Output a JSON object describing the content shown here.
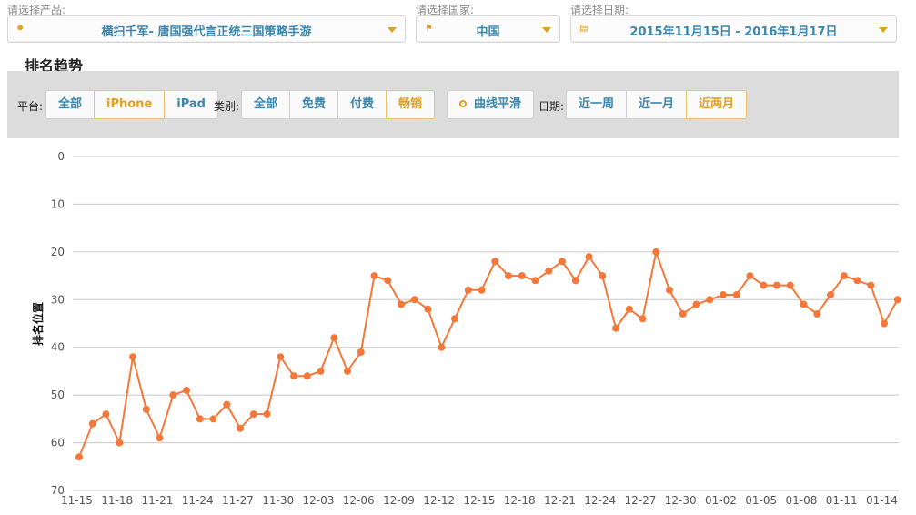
{
  "filters": {
    "product": {
      "label": "请选择产品:",
      "value": "横扫千军- 唐国强代言正统三国策略手游",
      "icon": "gear-icon"
    },
    "country": {
      "label": "请选择国家:",
      "value": "中国",
      "icon": "flag-icon"
    },
    "date": {
      "label": "请选择日期:",
      "value": "2015年11月15日 - 2016年1月17日",
      "icon": "calendar-icon"
    }
  },
  "section_title": "排名趋势",
  "toolbar": {
    "platform": {
      "label": "平台:",
      "options": [
        "全部",
        "iPhone",
        "iPad"
      ],
      "selected": "iPhone"
    },
    "category": {
      "label": "类别:",
      "options": [
        "全部",
        "免费",
        "付费",
        "畅销"
      ],
      "selected": "畅销"
    },
    "smooth": {
      "label": "曲线平滑"
    },
    "period": {
      "label": "日期:",
      "options": [
        "近一周",
        "近一月",
        "近两月"
      ],
      "selected": "近两月"
    }
  },
  "colors": {
    "accent": "#e0a020",
    "link": "#3a86ae",
    "line": "#f4783a",
    "grid": "#c8c8c8"
  },
  "chart_data": {
    "type": "line",
    "ylabel": "排名位置",
    "ylim": [
      70,
      0
    ],
    "y_reversed": true,
    "yticks": [
      0,
      10,
      20,
      30,
      40,
      50,
      60,
      70
    ],
    "xtick_labels": [
      "11-15",
      "11-18",
      "11-21",
      "11-24",
      "11-27",
      "11-30",
      "12-03",
      "12-06",
      "12-09",
      "12-12",
      "12-15",
      "12-18",
      "12-21",
      "12-24",
      "12-27",
      "12-30",
      "01-02",
      "01-05",
      "01-08",
      "01-11",
      "01-14"
    ],
    "grid": true,
    "x_start": "2015-11-15",
    "series": [
      {
        "values": [
          63,
          56,
          54,
          60,
          42,
          53,
          59,
          50,
          49,
          55,
          55,
          52,
          57,
          54,
          54,
          42,
          46,
          46,
          45,
          38,
          45,
          41,
          25,
          26,
          31,
          30,
          32,
          40,
          34,
          28,
          28,
          22,
          25,
          25,
          26,
          24,
          22,
          26,
          21,
          25,
          36,
          32,
          34,
          20,
          28,
          33,
          31,
          30,
          29,
          29,
          25,
          27,
          27,
          27,
          31,
          33,
          29,
          25,
          26,
          27,
          35,
          30
        ]
      }
    ]
  }
}
